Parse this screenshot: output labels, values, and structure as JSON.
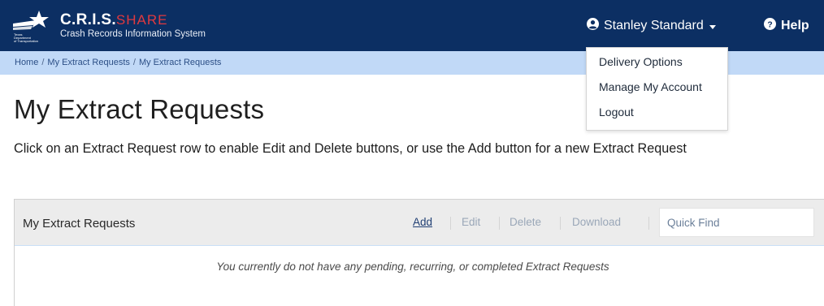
{
  "header": {
    "brand_title": "C.R.I.S.",
    "brand_title_accent": "SHARE",
    "brand_subtitle": "Crash Records Information System",
    "logo_text": "Texas Department of Transportation",
    "user_name": "Stanley Standard",
    "help_label": "Help"
  },
  "user_dropdown": {
    "items": [
      "Delivery Options",
      "Manage My Account",
      "Logout"
    ]
  },
  "breadcrumb": {
    "items": [
      "Home",
      "My Extract Requests",
      "My Extract Requests"
    ],
    "separator": "/"
  },
  "page": {
    "title": "My Extract Requests",
    "instructions": "Click on an Extract Request row to enable Edit and Delete buttons, or use the Add button for a new Extract Request"
  },
  "panel": {
    "title": "My Extract Requests",
    "actions": {
      "add": "Add",
      "edit": "Edit",
      "delete": "Delete",
      "download": "Download"
    },
    "quick_find_placeholder": "Quick Find",
    "quick_find_value": "",
    "empty_message": "You currently do not have any pending, recurring, or completed Extract Requests"
  },
  "colors": {
    "navbar": "#0c2f63",
    "breadcrumb_bar": "#c1d9f7",
    "accent_red": "#e0393f",
    "link": "#1f3e73",
    "disabled_action": "#9aa7b8"
  },
  "icons": {
    "user": "user-circle-icon",
    "help": "question-circle-icon",
    "caret": "caret-down-icon",
    "logo": "txdot-star-logo"
  }
}
